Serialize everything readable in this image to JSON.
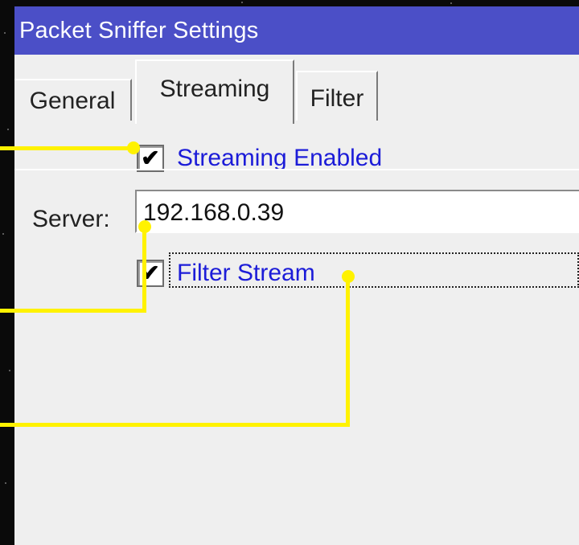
{
  "window": {
    "title": "Packet Sniffer Settings"
  },
  "tabs": [
    {
      "label": "General",
      "active": false
    },
    {
      "label": "Streaming",
      "active": true
    },
    {
      "label": "Filter",
      "active": false
    }
  ],
  "streaming": {
    "streaming_enabled": {
      "label": "Streaming Enabled",
      "checked": true,
      "check_glyph": "✔"
    },
    "server": {
      "label": "Server:",
      "value": "192.168.0.39"
    },
    "filter_stream": {
      "label": "Filter Stream",
      "checked": true,
      "check_glyph": "✔",
      "focused": true
    }
  },
  "colors": {
    "titlebar": "#4b4fc7",
    "label_blue": "#1c1cd8",
    "callout": "#fff200",
    "panel": "#efefef"
  }
}
